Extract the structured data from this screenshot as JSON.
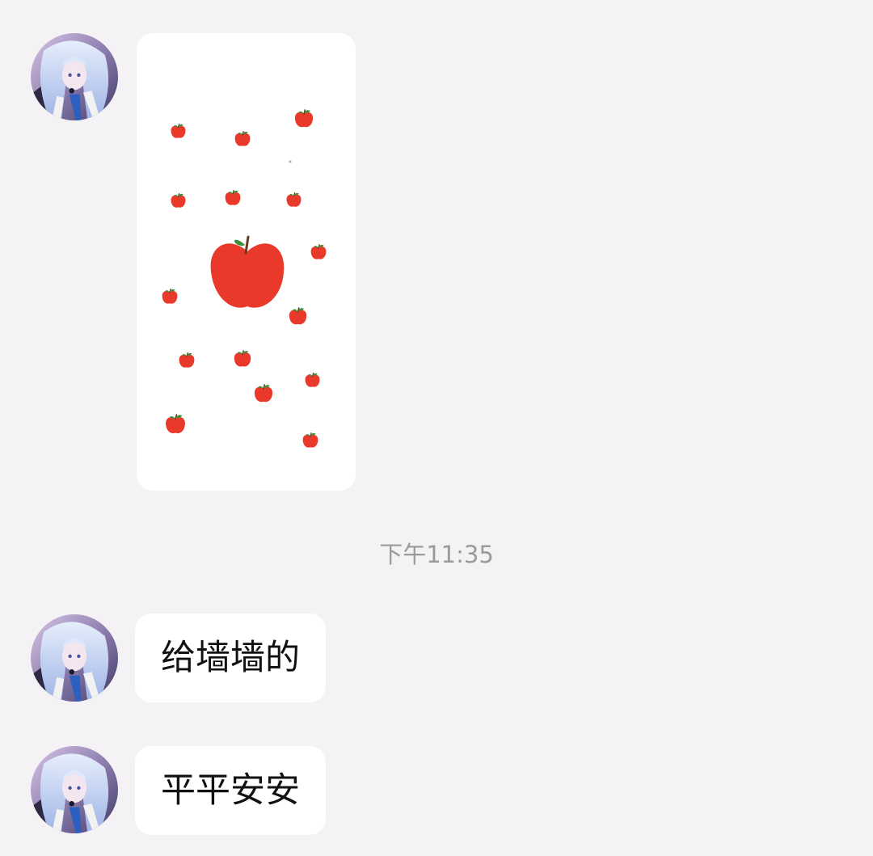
{
  "conversation": {
    "messages": [
      {
        "type": "image",
        "sender_avatar": "anime-character-avatar",
        "image_content": "apple-pattern-wallpaper"
      },
      {
        "type": "timestamp",
        "text": "下午11:35"
      },
      {
        "type": "text",
        "sender_avatar": "anime-character-avatar",
        "text": "给墙墙的"
      },
      {
        "type": "text",
        "sender_avatar": "anime-character-avatar",
        "text": "平平安安"
      }
    ]
  },
  "colors": {
    "background": "#f5f2f5",
    "bubble": "#ffffff",
    "timestamp_text": "#9a9a9a",
    "message_text": "#111111",
    "apple_red": "#e8392a",
    "apple_leaf": "#3d8f3a"
  }
}
